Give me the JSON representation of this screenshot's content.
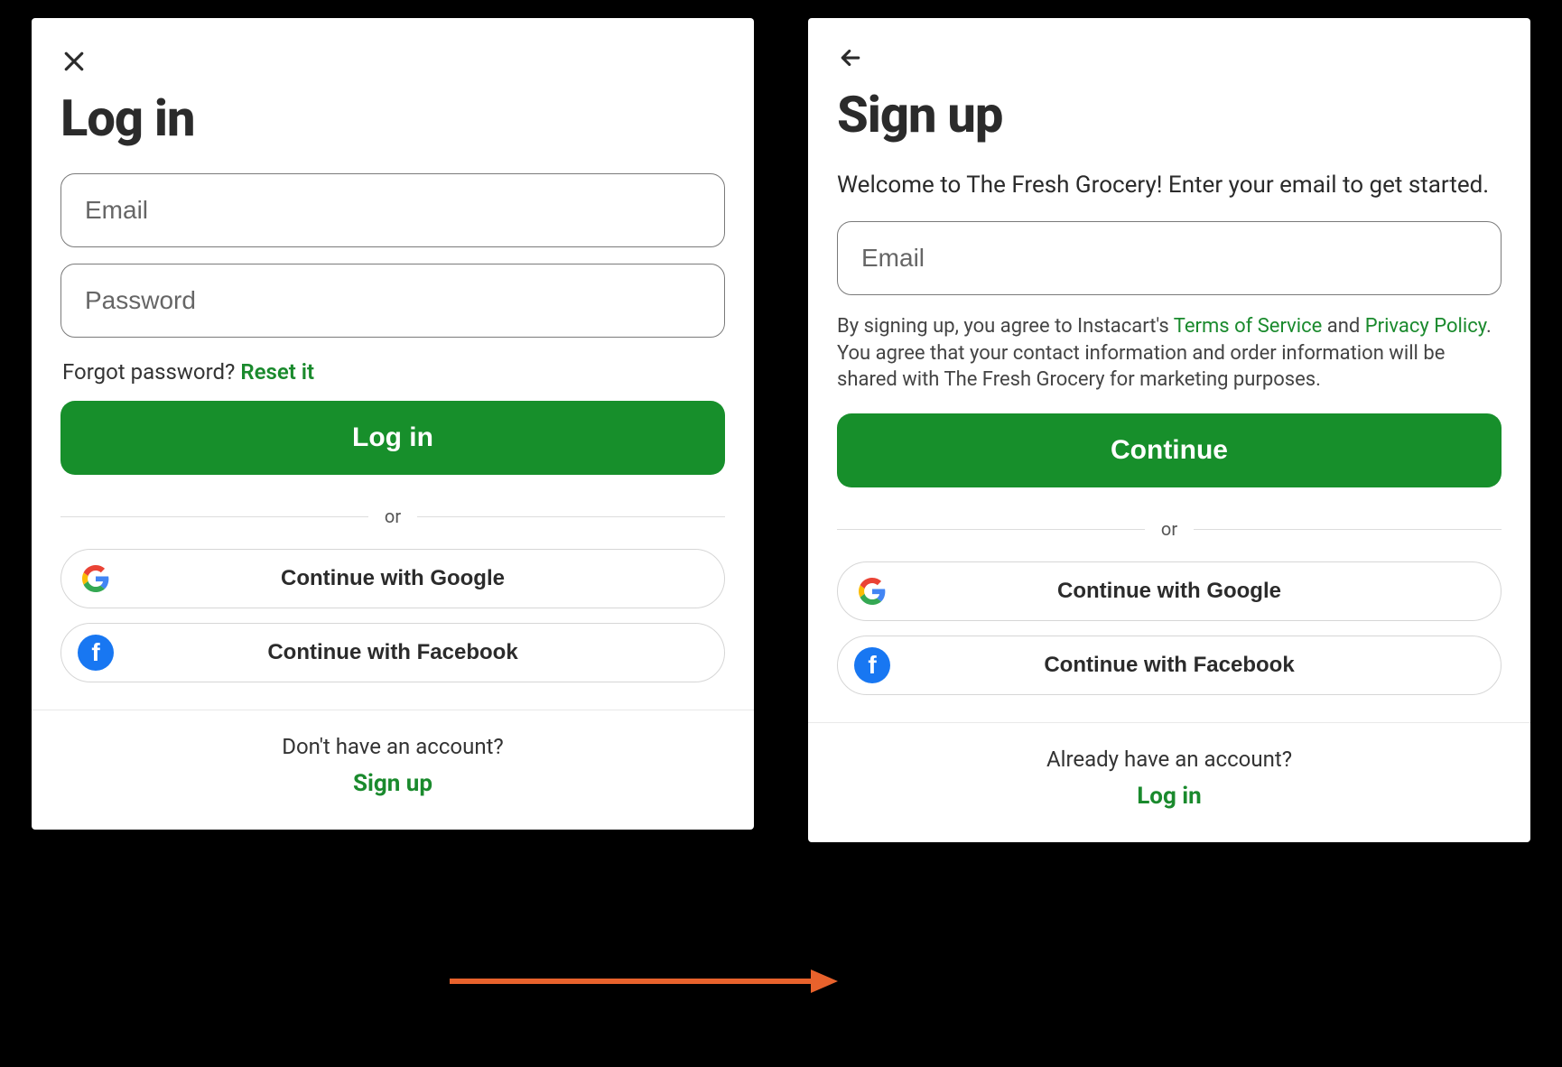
{
  "colors": {
    "accent": "#178f2b",
    "link": "#1a8a2d",
    "facebook": "#1877F2",
    "annotation": "#E8622C"
  },
  "login": {
    "title": "Log in",
    "email_placeholder": "Email",
    "password_placeholder": "Password",
    "forgot_prefix": "Forgot password? ",
    "forgot_link": "Reset it",
    "submit_label": "Log in",
    "or_label": "or",
    "google_label": "Continue with Google",
    "facebook_label": "Continue with Facebook",
    "footer_question": "Don't have an account?",
    "footer_action": "Sign up"
  },
  "signup": {
    "title": "Sign up",
    "subtitle": "Welcome to The Fresh Grocery! Enter your email to get started.",
    "email_placeholder": "Email",
    "legal_prefix": "By signing up, you agree to Instacart's ",
    "legal_tos": "Terms of Service",
    "legal_mid1": " and ",
    "legal_privacy": "Privacy Policy",
    "legal_suffix": ". You agree that your contact information and order information will be shared with The Fresh Grocery for marketing purposes.",
    "submit_label": "Continue",
    "or_label": "or",
    "google_label": "Continue with Google",
    "facebook_label": "Continue with Facebook",
    "footer_question": "Already have an account?",
    "footer_action": "Log in"
  }
}
